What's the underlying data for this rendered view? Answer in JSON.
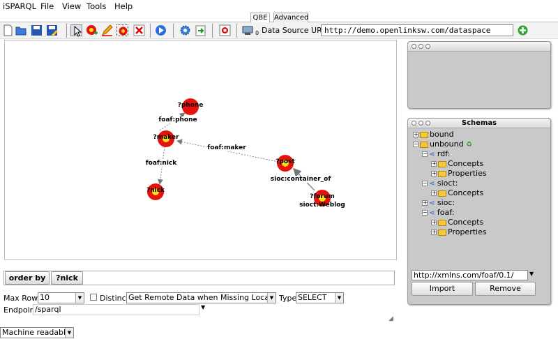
{
  "menu": [
    "iSPARQL",
    "File",
    "View",
    "Tools",
    "Help"
  ],
  "tabs": {
    "qbe": "QBE",
    "advanced": "Advanced"
  },
  "toolbar": {
    "icons": [
      "new-icon",
      "open-icon",
      "save-icon",
      "save-as-icon",
      "select-pointer-icon",
      "add-node-icon",
      "edit-icon",
      "group-icon",
      "delete-icon",
      "run-icon",
      "settings-icon",
      "export-icon",
      "stop-icon",
      "datasource-icon"
    ],
    "datasource_badge": "0",
    "datasource_label": "Data Source URI",
    "datasource_value": "http://demo.openlinksw.com/dataspace"
  },
  "graph": {
    "nodes": [
      {
        "id": "phone",
        "label": "?phone",
        "dot": false
      },
      {
        "id": "maker",
        "label": "?maker",
        "dot": true
      },
      {
        "id": "nick",
        "label": "?nick",
        "dot": true
      },
      {
        "id": "post",
        "label": "?post",
        "dot": true
      },
      {
        "id": "forum",
        "label": "?forum",
        "dot": true,
        "type": "sioct:Weblog"
      }
    ],
    "edges": [
      {
        "label": "foaf:phone"
      },
      {
        "label": "foaf:nick"
      },
      {
        "label": "foaf:maker"
      },
      {
        "label": "sioc:container_of"
      }
    ]
  },
  "orderby": {
    "button": "order by",
    "field": "?nick"
  },
  "options": {
    "max_rows_label": "Max Rows",
    "max_rows": "10",
    "distinct_label": "Distinct",
    "remote": "Get Remote Data when Missing Locally",
    "type_label": "Type",
    "type": "SELECT",
    "endpoint_label": "Endpoint",
    "endpoint": "/sparql"
  },
  "schemas": {
    "title": "Schemas",
    "items": [
      {
        "label": "bound",
        "kind": "folder",
        "level": 0
      },
      {
        "label": "unbound",
        "kind": "folder",
        "level": 0
      },
      {
        "label": "rdf:",
        "kind": "ns",
        "level": 1
      },
      {
        "label": "Concepts",
        "kind": "folder",
        "level": 2
      },
      {
        "label": "Properties",
        "kind": "folder",
        "level": 2
      },
      {
        "label": "sioct:",
        "kind": "ns",
        "level": 1
      },
      {
        "label": "Concepts",
        "kind": "folder",
        "level": 2
      },
      {
        "label": "sioc:",
        "kind": "ns",
        "level": 1
      },
      {
        "label": "foaf:",
        "kind": "ns",
        "level": 1
      },
      {
        "label": "Concepts",
        "kind": "folder",
        "level": 2
      },
      {
        "label": "Properties",
        "kind": "folder",
        "level": 2
      }
    ],
    "uri": "http://xmlns.com/foaf/0.1/",
    "import": "Import",
    "remove": "Remove"
  },
  "footer": {
    "format": "Machine readable"
  }
}
